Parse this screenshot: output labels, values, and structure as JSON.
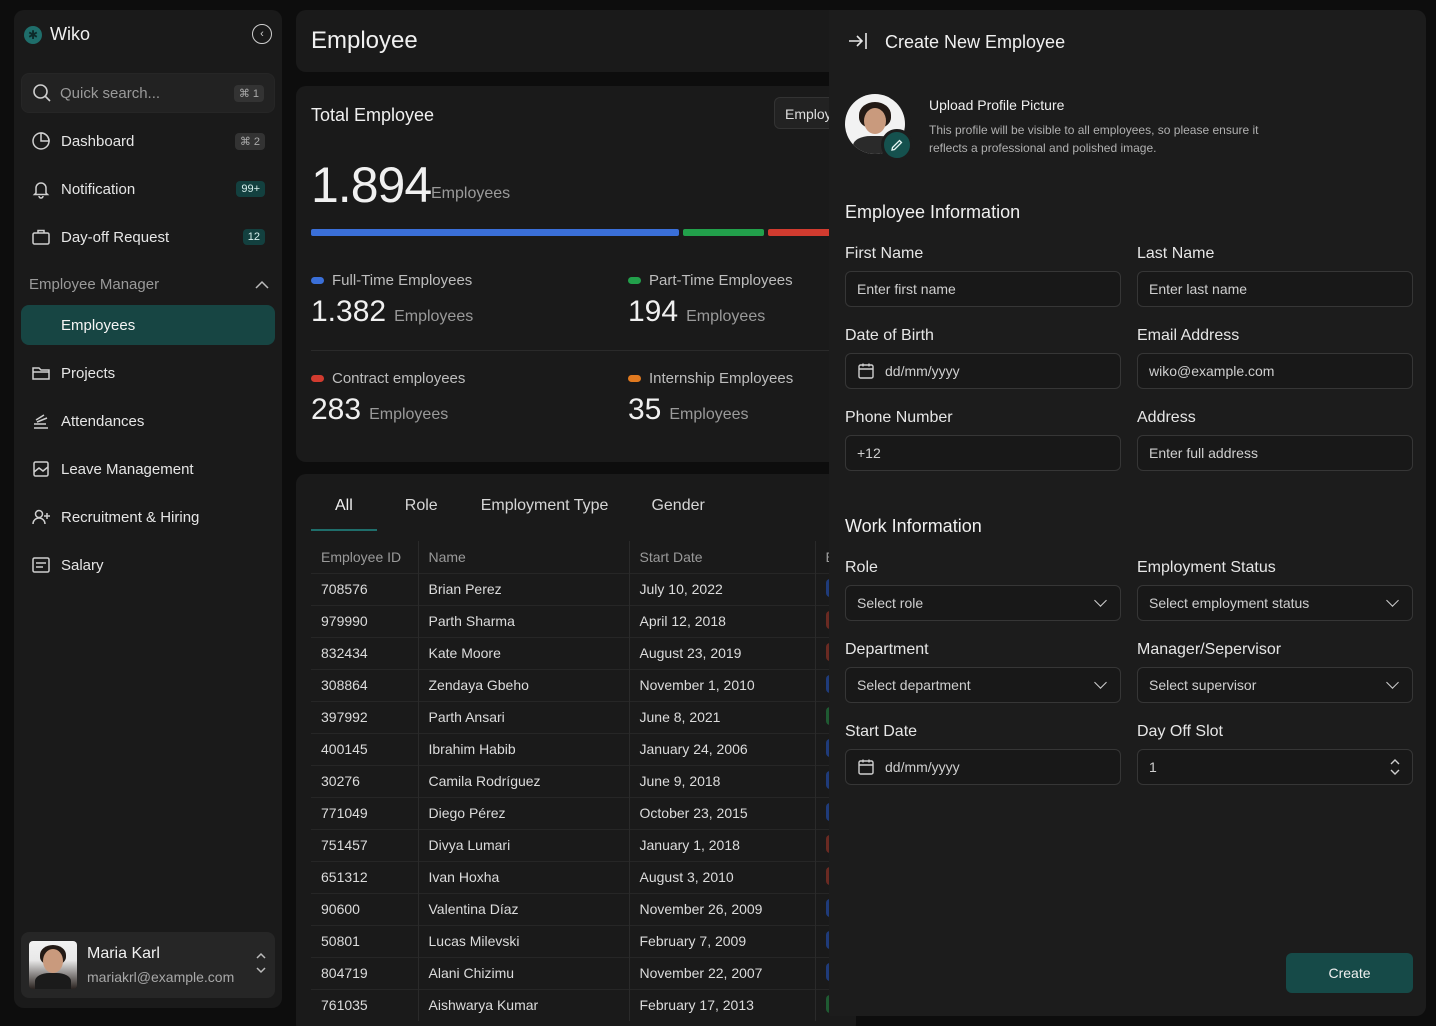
{
  "app": {
    "name": "Wiko"
  },
  "sidebar": {
    "search": {
      "placeholder": "Quick search...",
      "shortcut": "⌘ 1"
    },
    "items": [
      {
        "label": "Dashboard",
        "icon": "dashboard-icon",
        "badge": "⌘ 2"
      },
      {
        "label": "Notification",
        "icon": "bell-icon",
        "badge": "99+"
      },
      {
        "label": "Day-off Request",
        "icon": "briefcase-icon",
        "badge": "12"
      }
    ],
    "section": {
      "label": "Employee Manager"
    },
    "section_items": [
      {
        "label": "Employees",
        "active": true
      },
      {
        "label": "Projects",
        "icon": "folder-icon"
      },
      {
        "label": "Attendances",
        "icon": "stack-icon"
      },
      {
        "label": "Leave Management",
        "icon": "calendar-image-icon"
      },
      {
        "label": "Recruitment & Hiring",
        "icon": "user-plus-icon"
      },
      {
        "label": "Salary",
        "icon": "receipt-icon"
      }
    ],
    "user": {
      "name": "Maria Karl",
      "email": "mariakrl@example.com"
    }
  },
  "header": {
    "title": "Employee"
  },
  "stats": {
    "title": "Total Employee",
    "filter": "Employee",
    "total": "1.894",
    "total_unit": "Employees",
    "categories": [
      {
        "label": "Full-Time Employees",
        "value": "1.382",
        "unit": "Employees",
        "color": "#3a6fd8"
      },
      {
        "label": "Part-Time Employees",
        "value": "194",
        "unit": "Employees",
        "color": "#22a04b"
      },
      {
        "label": "Contract employees",
        "value": "283",
        "unit": "Employees",
        "color": "#d13b2f"
      },
      {
        "label": "Internship Employees",
        "value": "35",
        "unit": "Employees",
        "color": "#e0791f"
      }
    ]
  },
  "table": {
    "tabs": [
      "All",
      "Role",
      "Employment Type",
      "Gender"
    ],
    "columns": [
      "Employee ID",
      "Name",
      "Start Date",
      "E"
    ],
    "rows": [
      {
        "id": "708576",
        "name": "Brian Perez",
        "start": "July 10, 2022",
        "status_color": "#1f3b7a"
      },
      {
        "id": "979990",
        "name": "Parth Sharma",
        "start": "April 12, 2018",
        "status_color": "#6a2a22"
      },
      {
        "id": "832434",
        "name": "Kate Moore",
        "start": "August 23, 2019",
        "status_color": "#6a2a22"
      },
      {
        "id": "308864",
        "name": "Zendaya Gbeho",
        "start": "November 1, 2010",
        "status_color": "#1f3b7a"
      },
      {
        "id": "397992",
        "name": "Parth Ansari",
        "start": "June 8, 2021",
        "status_color": "#1f5a32"
      },
      {
        "id": "400145",
        "name": "Ibrahim Habib",
        "start": "January 24, 2006",
        "status_color": "#1f3b7a"
      },
      {
        "id": "30276",
        "name": "Camila Rodríguez",
        "start": "June 9, 2018",
        "status_color": "#1f3b7a"
      },
      {
        "id": "771049",
        "name": "Diego Pérez",
        "start": "October 23, 2015",
        "status_color": "#1f3b7a"
      },
      {
        "id": "751457",
        "name": "Divya Lumari",
        "start": "January 1, 2018",
        "status_color": "#6a2a22"
      },
      {
        "id": "651312",
        "name": "Ivan Hoxha",
        "start": "August 3, 2010",
        "status_color": "#6a2a22"
      },
      {
        "id": "90600",
        "name": "Valentina Díaz",
        "start": "November 26, 2009",
        "status_color": "#1f3b7a"
      },
      {
        "id": "50801",
        "name": "Lucas Milevski",
        "start": "February 7, 2009",
        "status_color": "#1f3b7a"
      },
      {
        "id": "804719",
        "name": "Alani Chizimu",
        "start": "November 22, 2007",
        "status_color": "#1f3b7a"
      },
      {
        "id": "761035",
        "name": "Aishwarya Kumar",
        "start": "February 17, 2013",
        "status_color": "#1f5a32"
      }
    ]
  },
  "drawer": {
    "title": "Create New Employee",
    "upload": {
      "title": "Upload Profile Picture",
      "desc": "This profile will be visible to all employees, so please ensure it reflects a professional and polished image."
    },
    "employee_section": "Employee Information",
    "work_section": "Work Information",
    "fields": {
      "first_name": {
        "label": "First Name",
        "placeholder": "Enter first name"
      },
      "last_name": {
        "label": "Last Name",
        "placeholder": "Enter last name"
      },
      "dob": {
        "label": "Date of Birth",
        "placeholder": "dd/mm/yyyy"
      },
      "email": {
        "label": "Email Address",
        "placeholder": "wiko@example.com"
      },
      "phone": {
        "label": "Phone Number",
        "placeholder": "+12"
      },
      "address": {
        "label": "Address",
        "placeholder": "Enter full address"
      },
      "role": {
        "label": "Role",
        "placeholder": "Select role"
      },
      "status": {
        "label": "Employment Status",
        "placeholder": "Select employment status"
      },
      "department": {
        "label": "Department",
        "placeholder": "Select department"
      },
      "manager": {
        "label": "Manager/Sepervisor",
        "placeholder": "Select supervisor"
      },
      "start_date": {
        "label": "Start Date",
        "placeholder": "dd/mm/yyyy"
      },
      "day_off": {
        "label": "Day Off Slot",
        "value": "1"
      }
    },
    "create_label": "Create"
  }
}
